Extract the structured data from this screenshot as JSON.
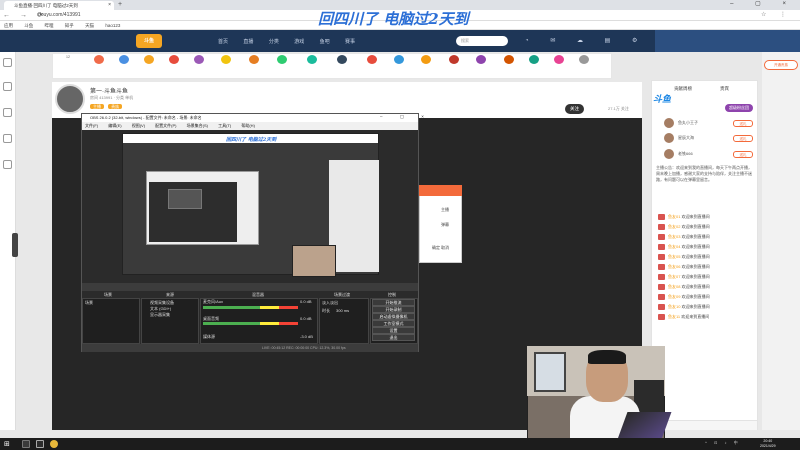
{
  "browser": {
    "tab_title": "斗鱼直播·回四川了 电脑过2天到",
    "close_glyph": "×",
    "new_tab_glyph": "+",
    "window_controls": "– ▢ ×",
    "url": "douyu.com/413991",
    "nav_glyphs": "← → ⟳",
    "toolbar_glyphs": "☆ ⋮",
    "bookmarks": [
      "应用",
      "斗鱼",
      "哔哩",
      "知乎",
      "天猫",
      "hao123"
    ]
  },
  "overlay_title": "回四川了  电脑过2天到",
  "douyu": {
    "logo_text": "斗鱼",
    "nav": [
      "首页",
      "直播",
      "分类",
      "游戏",
      "鱼吧",
      "赛事"
    ],
    "search_placeholder": "搜索",
    "header_icons": "◔ ✉ ☁ ▤ ⚙ ◉",
    "gift_count_label": "12"
  },
  "streamer": {
    "name": "第一·斗鱼斗鱼",
    "subtitle": "房间 413991 · 分类 单机",
    "tags": [
      "主播",
      "贵族"
    ],
    "follow_label": "关注",
    "follow_count": "27.1万 关注"
  },
  "obs": {
    "title": "OBS 26.0.2 (32-bit, windows) - 配置文件: 未命名 - 场景: 未命名",
    "title_controls": "– ▢ ×",
    "menu": [
      "文件(F)",
      "编辑(E)",
      "视图(V)",
      "配置文件(P)",
      "场景集合(S)",
      "工具(T)",
      "帮助(H)"
    ],
    "preview_title": "回四川了  电脑过2天到",
    "docks": {
      "scenes_title": "场景",
      "sources_title": "来源",
      "mixer_title": "混音器",
      "transitions_title": "场景过渡",
      "controls_title": "控制"
    },
    "scene_item": "场景",
    "sources": [
      "视频采集设备",
      "文本 (GDI+)",
      "显示器采集"
    ],
    "mixer": [
      "麦克风/Aux",
      "桌面音频",
      "媒体源"
    ],
    "mixer_db": [
      "0.0 dB",
      "0.0 dB",
      "-3.0 dB"
    ],
    "transition_value": "淡入淡出",
    "duration_label": "时长",
    "duration_value": "300 ms",
    "controls": [
      "开始推流",
      "开始录制",
      "启动虚拟摄像机",
      "工作室模式",
      "设置",
      "退出"
    ],
    "status": "LIVE: 00:45:12   REC: 00:00:00   CPU: 12.3%, 30.00 fps"
  },
  "popup": {
    "line1": "主播",
    "line2": "弹幕",
    "line3": "确定  取消"
  },
  "right_panel": {
    "logo": "斗鱼",
    "tab1": "贡献周榜",
    "tab2": "贵宾",
    "badge": "超级粉丝团",
    "ranks": [
      {
        "name": "鱼丸小王子",
        "btn": "送礼"
      },
      {
        "name": "星辰大海",
        "btn": "送礼"
      },
      {
        "name": "老铁666",
        "btn": "送礼"
      }
    ],
    "announcement": "主播公告：欢迎来到我的直播间，每天下午两点开播，周末晚上加播，感谢大家的支持与陪伴，关注主播不迷路，有问题可以在弹幕里留言。",
    "chats": [
      {
        "user": "鱼友01",
        "text": "欢迎来到直播间"
      },
      {
        "user": "鱼友02",
        "text": "欢迎来到直播间"
      },
      {
        "user": "鱼友03",
        "text": "欢迎来到直播间"
      },
      {
        "user": "鱼友04",
        "text": "欢迎来到直播间"
      },
      {
        "user": "鱼友05",
        "text": "欢迎来到直播间"
      },
      {
        "user": "鱼友06",
        "text": "欢迎来到直播间"
      },
      {
        "user": "鱼友07",
        "text": "欢迎来到直播间"
      },
      {
        "user": "鱼友08",
        "text": "欢迎来到直播间"
      },
      {
        "user": "鱼友09",
        "text": "欢迎来到直播间"
      },
      {
        "user": "鱼友10",
        "text": "欢迎来到直播间"
      },
      {
        "user": "鱼友11",
        "text": "欢迎来到直播间"
      }
    ],
    "far_tab": "开通贵族"
  },
  "taskbar": {
    "start_glyph": "⊞",
    "tray": "^ ⊡ ♪ 中",
    "time": "20:40",
    "date": "2021/4/29"
  }
}
